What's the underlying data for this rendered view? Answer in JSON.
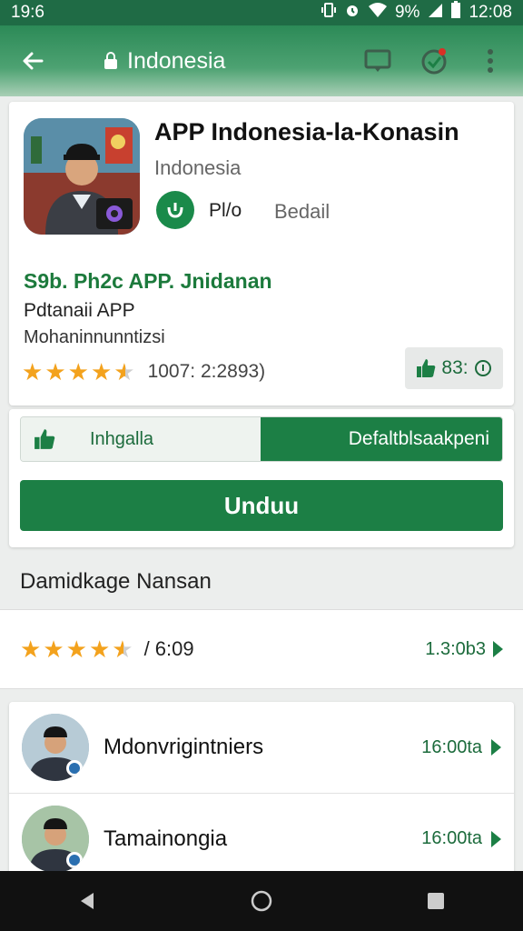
{
  "status_bar": {
    "time_left": "19:6",
    "signal_text": "9%",
    "time_right": "12:08"
  },
  "app_bar": {
    "title": "Indonesia",
    "back_icon": "arrow-left-icon",
    "lock_icon": "lock-icon",
    "cast_icon": "cast-icon",
    "account_icon": "account-check-icon",
    "menu_icon": "more-vert-icon"
  },
  "app": {
    "title": "APP Indonesia-la-Konasin",
    "subtitle": "Indonesia",
    "badge_label": "Pl/o",
    "detail_label": "Bedail",
    "promo_title": "S9b. Ph2c APP. Jnidanan",
    "promo_line1": "Pdtanaii APP",
    "promo_line2": "Mohaninnunntizsi",
    "rating_value": 4.5,
    "rating_count": "1007: 2:2893)",
    "like_count": "83:"
  },
  "actions": {
    "toggle_left_label": "Inhgalla",
    "toggle_right_label": "Defaltblsaakpeni",
    "download_label": "Unduu"
  },
  "reviews_section": {
    "header": "Damidkage Nansan",
    "rating_value": 4.5,
    "score_text": "/ 6:09",
    "link_text": "1.3:0b3"
  },
  "reviewers": [
    {
      "name": "Mdonvrigintniers",
      "link_text": "16:00ta"
    },
    {
      "name": "Tamainongia",
      "link_text": "16:00ta"
    }
  ],
  "colors": {
    "primary": "#1c7f45",
    "accent_star": "#f3a21d",
    "app_bar": "#2c8a57"
  }
}
